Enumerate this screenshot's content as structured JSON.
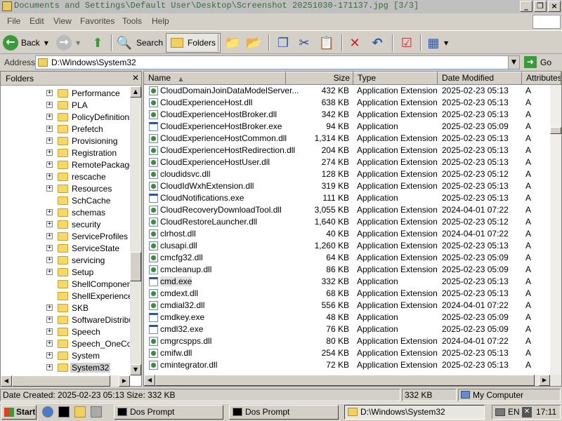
{
  "window": {
    "title": "Documents and Settings\\Default User\\Desktop\\Screenshot 20251030-171137.jpg [3/3]"
  },
  "menu": {
    "items": [
      "File",
      "Edit",
      "View",
      "Favorites",
      "Tools",
      "Help"
    ]
  },
  "toolbar": {
    "back_label": "Back",
    "search_label": "Search",
    "folders_label": "Folders"
  },
  "address": {
    "label": "Address",
    "value": "D:\\Windows\\System32",
    "go_label": "Go"
  },
  "folders_pane": {
    "title": "Folders",
    "items": [
      {
        "label": "Performance",
        "expandable": true
      },
      {
        "label": "PLA",
        "expandable": true
      },
      {
        "label": "PolicyDefinitions",
        "expandable": true
      },
      {
        "label": "Prefetch",
        "expandable": true
      },
      {
        "label": "Provisioning",
        "expandable": true
      },
      {
        "label": "Registration",
        "expandable": true
      },
      {
        "label": "RemotePackages",
        "expandable": true
      },
      {
        "label": "rescache",
        "expandable": true
      },
      {
        "label": "Resources",
        "expandable": true
      },
      {
        "label": "SchCache",
        "expandable": false
      },
      {
        "label": "schemas",
        "expandable": true
      },
      {
        "label": "security",
        "expandable": true
      },
      {
        "label": "ServiceProfiles",
        "expandable": true
      },
      {
        "label": "ServiceState",
        "expandable": true
      },
      {
        "label": "servicing",
        "expandable": true
      },
      {
        "label": "Setup",
        "expandable": true
      },
      {
        "label": "ShellComponents",
        "expandable": false
      },
      {
        "label": "ShellExperiences",
        "expandable": false
      },
      {
        "label": "SKB",
        "expandable": true
      },
      {
        "label": "SoftwareDistribution",
        "expandable": true
      },
      {
        "label": "Speech",
        "expandable": true
      },
      {
        "label": "Speech_OneCore",
        "expandable": true
      },
      {
        "label": "System",
        "expandable": true
      },
      {
        "label": "System32",
        "expandable": true,
        "selected": true
      }
    ]
  },
  "file_list": {
    "columns": [
      "Name",
      "Size",
      "Type",
      "Date Modified",
      "Attributes"
    ],
    "rows": [
      {
        "name": "CloudDomainJoinDataModelServer...",
        "size": "432 KB",
        "type": "Application Extension",
        "date": "2025-02-23 05:13",
        "attr": "A",
        "kind": "dll"
      },
      {
        "name": "CloudExperienceHost.dll",
        "size": "638 KB",
        "type": "Application Extension",
        "date": "2025-02-23 05:13",
        "attr": "A",
        "kind": "dll"
      },
      {
        "name": "CloudExperienceHostBroker.dll",
        "size": "342 KB",
        "type": "Application Extension",
        "date": "2025-02-23 05:13",
        "attr": "A",
        "kind": "dll"
      },
      {
        "name": "CloudExperienceHostBroker.exe",
        "size": "94 KB",
        "type": "Application",
        "date": "2025-02-23 05:09",
        "attr": "A",
        "kind": "exe"
      },
      {
        "name": "CloudExperienceHostCommon.dll",
        "size": "1,314 KB",
        "type": "Application Extension",
        "date": "2025-02-23 05:13",
        "attr": "A",
        "kind": "dll"
      },
      {
        "name": "CloudExperienceHostRedirection.dll",
        "size": "204 KB",
        "type": "Application Extension",
        "date": "2025-02-23 05:13",
        "attr": "A",
        "kind": "dll"
      },
      {
        "name": "CloudExperienceHostUser.dll",
        "size": "274 KB",
        "type": "Application Extension",
        "date": "2025-02-23 05:13",
        "attr": "A",
        "kind": "dll"
      },
      {
        "name": "cloudidsvc.dll",
        "size": "128 KB",
        "type": "Application Extension",
        "date": "2025-02-23 05:12",
        "attr": "A",
        "kind": "dll"
      },
      {
        "name": "CloudIdWxhExtension.dll",
        "size": "319 KB",
        "type": "Application Extension",
        "date": "2025-02-23 05:13",
        "attr": "A",
        "kind": "dll"
      },
      {
        "name": "CloudNotifications.exe",
        "size": "111 KB",
        "type": "Application",
        "date": "2025-02-23 05:13",
        "attr": "A",
        "kind": "exe"
      },
      {
        "name": "CloudRecoveryDownloadTool.dll",
        "size": "3,055 KB",
        "type": "Application Extension",
        "date": "2024-04-01 07:22",
        "attr": "A",
        "kind": "dll"
      },
      {
        "name": "CloudRestoreLauncher.dll",
        "size": "1,640 KB",
        "type": "Application Extension",
        "date": "2025-02-23 05:12",
        "attr": "A",
        "kind": "dll"
      },
      {
        "name": "clrhost.dll",
        "size": "40 KB",
        "type": "Application Extension",
        "date": "2024-04-01 07:22",
        "attr": "A",
        "kind": "dll"
      },
      {
        "name": "clusapi.dll",
        "size": "1,260 KB",
        "type": "Application Extension",
        "date": "2025-02-23 05:13",
        "attr": "A",
        "kind": "dll"
      },
      {
        "name": "cmcfg32.dll",
        "size": "64 KB",
        "type": "Application Extension",
        "date": "2025-02-23 05:09",
        "attr": "A",
        "kind": "dll"
      },
      {
        "name": "cmcleanup.dll",
        "size": "86 KB",
        "type": "Application Extension",
        "date": "2025-02-23 05:09",
        "attr": "A",
        "kind": "dll"
      },
      {
        "name": "cmd.exe",
        "size": "332 KB",
        "type": "Application",
        "date": "2025-02-23 05:13",
        "attr": "A",
        "kind": "exe",
        "highlight": true
      },
      {
        "name": "cmdext.dll",
        "size": "68 KB",
        "type": "Application Extension",
        "date": "2025-02-23 05:13",
        "attr": "A",
        "kind": "dll"
      },
      {
        "name": "cmdial32.dll",
        "size": "556 KB",
        "type": "Application Extension",
        "date": "2024-04-01 07:22",
        "attr": "A",
        "kind": "dll"
      },
      {
        "name": "cmdkey.exe",
        "size": "48 KB",
        "type": "Application",
        "date": "2025-02-23 05:09",
        "attr": "A",
        "kind": "exe"
      },
      {
        "name": "cmdl32.exe",
        "size": "76 KB",
        "type": "Application",
        "date": "2025-02-23 05:09",
        "attr": "A",
        "kind": "exe"
      },
      {
        "name": "cmgrcspps.dll",
        "size": "80 KB",
        "type": "Application Extension",
        "date": "2024-04-01 07:22",
        "attr": "A",
        "kind": "dll"
      },
      {
        "name": "cmifw.dll",
        "size": "254 KB",
        "type": "Application Extension",
        "date": "2025-02-23 05:13",
        "attr": "A",
        "kind": "dll"
      },
      {
        "name": "cmintegrator.dll",
        "size": "72 KB",
        "type": "Application Extension",
        "date": "2025-02-23 05:13",
        "attr": "A",
        "kind": "dll"
      }
    ]
  },
  "status": {
    "info": "Date Created: 2025-02-23 05:13 Size: 332 KB",
    "size": "332 KB",
    "zone": "My Computer"
  },
  "taskbar": {
    "start_label": "Start",
    "tasks": [
      {
        "label": "Dos Prompt",
        "icon": "console-icon"
      },
      {
        "label": "Dos Prompt",
        "icon": "console-icon"
      },
      {
        "label": "D:\\Windows\\System32",
        "icon": "folder-icon",
        "active": true
      }
    ],
    "language": "EN",
    "clock": "17:11"
  }
}
